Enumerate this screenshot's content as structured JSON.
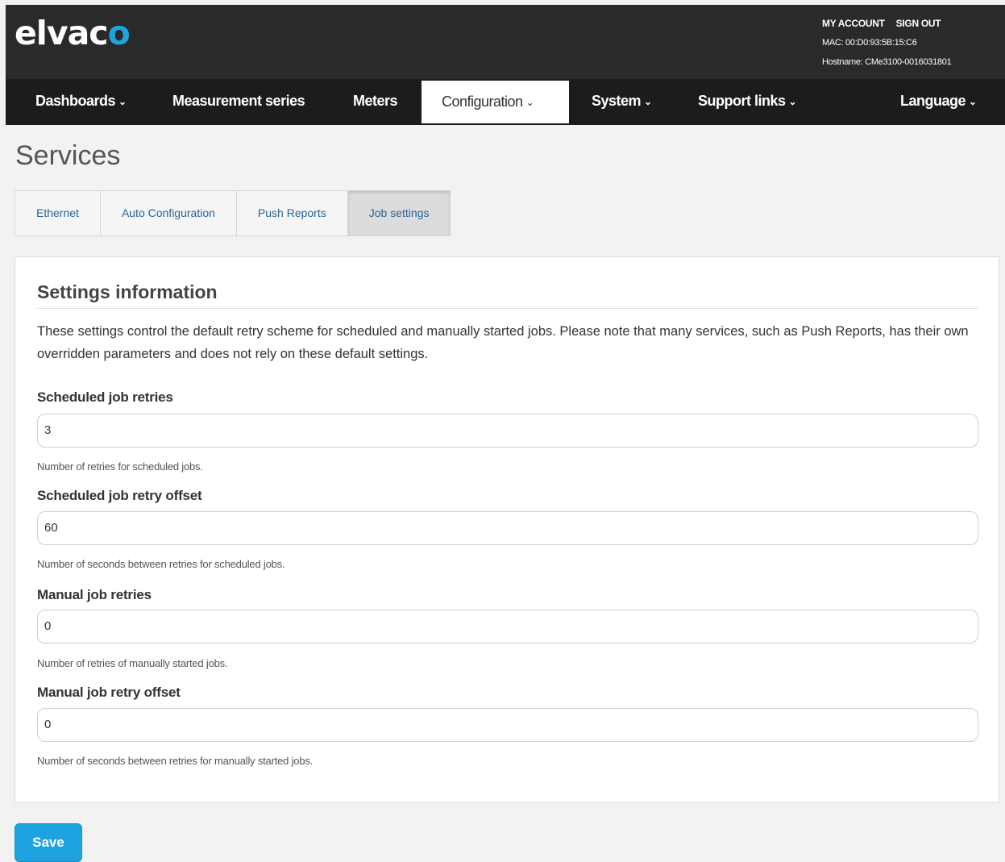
{
  "header": {
    "logo_main": "elvac",
    "logo_accent": "o",
    "my_account": "MY ACCOUNT",
    "sign_out": "SIGN OUT",
    "mac": "MAC: 00:D0:93:5B:15:C6",
    "hostname": "Hostname: CMe3100-0016031801"
  },
  "nav": {
    "items": [
      {
        "label": "Dashboards"
      },
      {
        "label": "Measurement series"
      },
      {
        "label": "Meters"
      },
      {
        "label": "Configuration"
      },
      {
        "label": "System"
      },
      {
        "label": "Support links"
      },
      {
        "label": "Language"
      }
    ],
    "active": "Configuration"
  },
  "page": {
    "title": "Services"
  },
  "tabs": {
    "items": [
      {
        "label": "Ethernet"
      },
      {
        "label": "Auto Configuration"
      },
      {
        "label": "Push Reports"
      },
      {
        "label": "Job settings"
      }
    ],
    "active": "Job settings"
  },
  "panel": {
    "title": "Settings information",
    "description": "These settings control the default retry scheme for scheduled and manually started jobs. Please note that many services, such as Push Reports, has their own overridden parameters and does not rely on these default settings.",
    "fields": [
      {
        "label": "Scheduled job retries",
        "value": "3",
        "help": "Number of retries for scheduled jobs."
      },
      {
        "label": "Scheduled job retry offset",
        "value": "60",
        "help": "Number of seconds between retries for scheduled jobs."
      },
      {
        "label": "Manual job retries",
        "value": "0",
        "help": "Number of retries of manually started jobs."
      },
      {
        "label": "Manual job retry offset",
        "value": "0",
        "help": "Number of seconds between retries for manually started jobs."
      }
    ]
  },
  "actions": {
    "save_label": "Save"
  },
  "colors": {
    "accent": "#1ea3e0",
    "topbar": "#2a2a2a",
    "navbar": "#1c1c1c"
  }
}
